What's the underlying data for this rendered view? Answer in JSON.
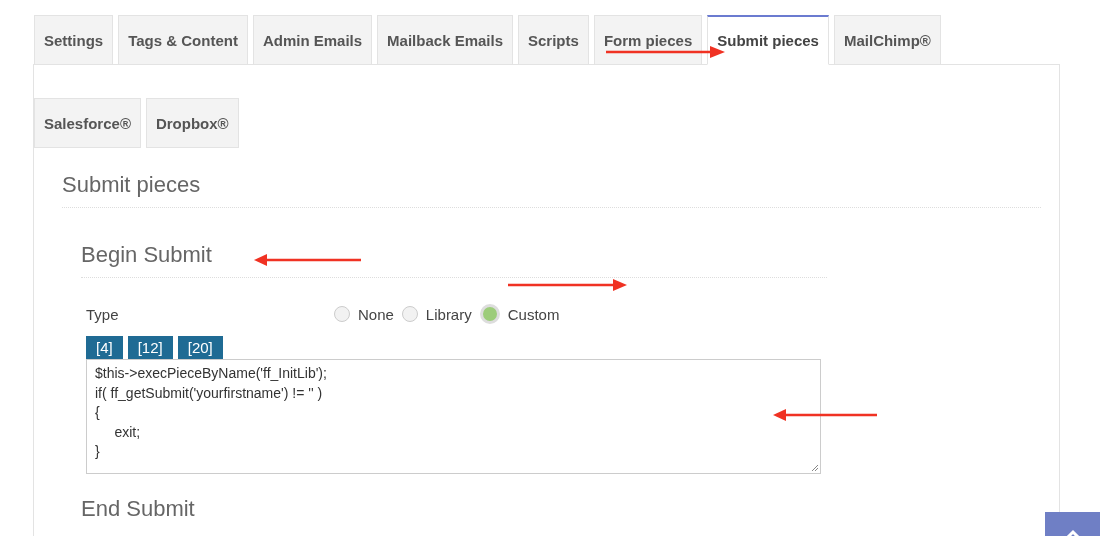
{
  "tabs": [
    {
      "label": "Settings",
      "selected": false
    },
    {
      "label": "Tags & Content",
      "selected": false
    },
    {
      "label": "Admin Emails",
      "selected": false
    },
    {
      "label": "Mailback Emails",
      "selected": false
    },
    {
      "label": "Scripts",
      "selected": false
    },
    {
      "label": "Form pieces",
      "selected": false
    },
    {
      "label": "Submit pieces",
      "selected": true
    },
    {
      "label": "MailChimp®",
      "selected": false
    },
    {
      "label": "Salesforce®",
      "selected": false
    },
    {
      "label": "Dropbox®",
      "selected": false
    }
  ],
  "panel_title": "Submit pieces",
  "section": {
    "title": "Begin Submit",
    "type_label": "Type",
    "options": [
      {
        "label": "None",
        "selected": false
      },
      {
        "label": "Library",
        "selected": false
      },
      {
        "label": "Custom",
        "selected": true
      }
    ],
    "indent_buttons": [
      "[4]",
      "[12]",
      "[20]"
    ],
    "code": "$this->execPieceByName('ff_InitLib');\nif( ff_getSubmit('yourfirstname') != '' )\n{\n     exit;\n}"
  },
  "next_section_title": "End Submit"
}
